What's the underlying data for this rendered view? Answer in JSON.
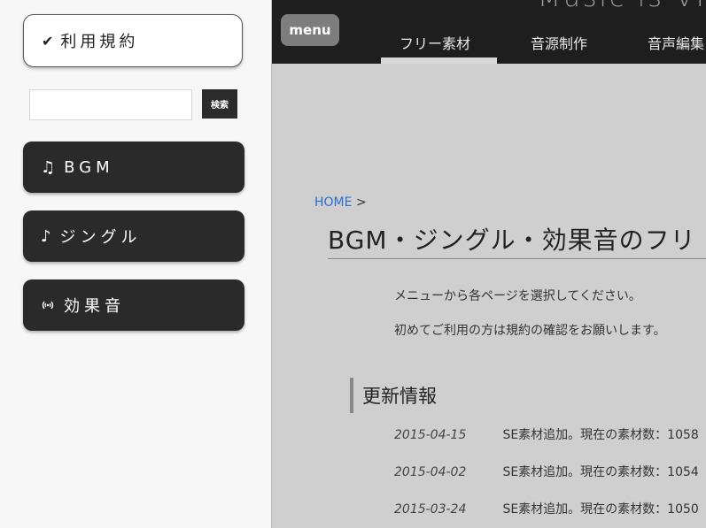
{
  "sidebar": {
    "terms_button": {
      "icon": "checkmark-icon",
      "label": "利用規約"
    },
    "search": {
      "placeholder": "",
      "value": "",
      "button_label": "検索"
    },
    "nav": [
      {
        "icon": "music-note-icon",
        "label": "BGM"
      },
      {
        "icon": "eighth-note-icon",
        "label": "ジングル"
      },
      {
        "icon": "broadcast-icon",
        "label": "効果音"
      }
    ]
  },
  "header": {
    "site_title": "Music is VI",
    "menu_label": "menu",
    "tabs": [
      {
        "label": "フリー素材",
        "active": true
      },
      {
        "label": "音源制作",
        "active": false
      },
      {
        "label": "音声編集",
        "active": false
      }
    ]
  },
  "main": {
    "breadcrumb": {
      "home": "HOME",
      "separator": ">"
    },
    "title": "BGM・ジングル・効果音のフリ",
    "intro": [
      "メニューから各ページを選択してください。",
      "初めてご利用の方は規約の確認をお願いします。"
    ],
    "updates_heading": "更新情報",
    "updates": [
      {
        "date": "2015-04-15",
        "text": "SE素材追加。現在の素材数：1058"
      },
      {
        "date": "2015-04-02",
        "text": "SE素材追加。現在の素材数：1054"
      },
      {
        "date": "2015-03-24",
        "text": "SE素材追加。現在の素材数：1050"
      }
    ]
  },
  "colors": {
    "sidebar_bg": "#f7f7f7",
    "main_bg": "#cfcfcf",
    "topbar_bg": "#1e1e1e",
    "nav_button_bg": "#2a2a2a",
    "link": "#2a6fd0"
  }
}
